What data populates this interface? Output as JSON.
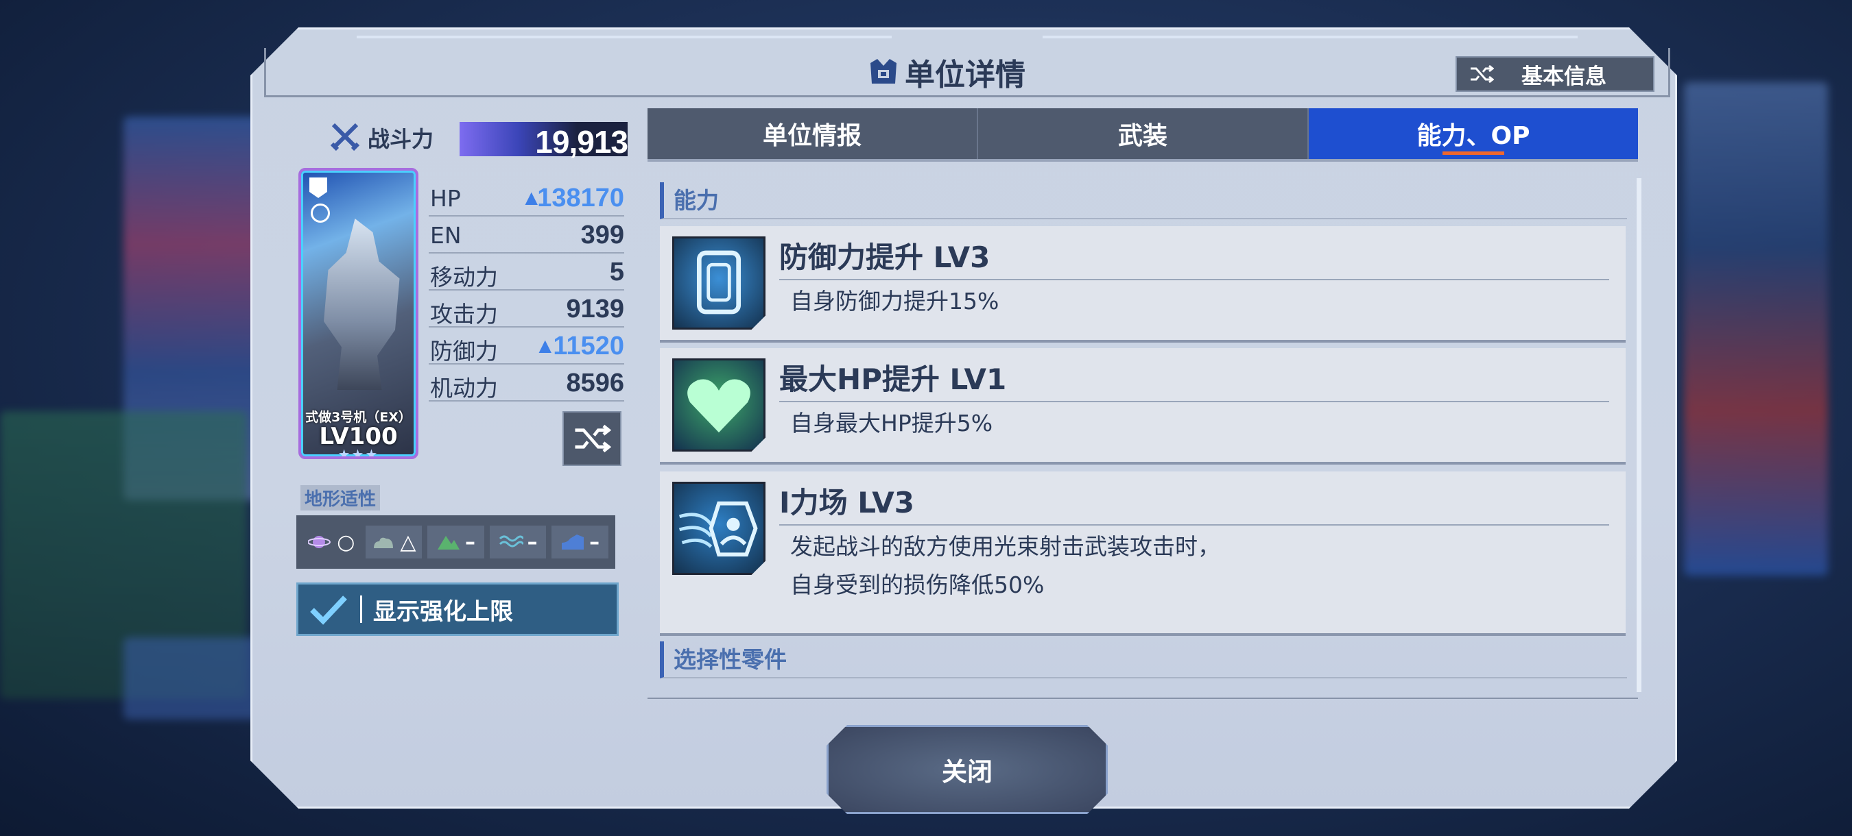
{
  "dialog": {
    "title": "单位详情",
    "basic_info_label": "基本信息",
    "close_label": "关闭"
  },
  "unit": {
    "power_label": "战斗力",
    "power_value": "19,913",
    "name": "式做3号机（EX）",
    "level": "LV100",
    "stars": "★★★",
    "stats": [
      {
        "label": "HP",
        "value": "138170",
        "boosted": true
      },
      {
        "label": "EN",
        "value": "399",
        "boosted": false
      },
      {
        "label": "移动力",
        "value": "5",
        "boosted": false
      },
      {
        "label": "攻击力",
        "value": "9139",
        "boosted": false
      },
      {
        "label": "防御力",
        "value": "11520",
        "boosted": true
      },
      {
        "label": "机动力",
        "value": "8596",
        "boosted": false
      }
    ]
  },
  "terrain": {
    "label": "地形适性",
    "items": [
      {
        "icon": "space-planet-icon",
        "grade": "○"
      },
      {
        "icon": "air-cloud-icon",
        "grade": "△"
      },
      {
        "icon": "land-mountain-icon",
        "grade": "–"
      },
      {
        "icon": "sea-wave-icon",
        "grade": "–"
      },
      {
        "icon": "underwater-icon",
        "grade": "–"
      }
    ]
  },
  "enhance_toggle": {
    "label": "显示强化上限",
    "checked": true
  },
  "tabs": [
    {
      "label": "单位情报",
      "active": false
    },
    {
      "label": "武装",
      "active": false
    },
    {
      "label": "能力、OP",
      "active": true
    }
  ],
  "abilities_section": "能力",
  "abilities": [
    {
      "name": "防御力提升 LV3",
      "desc": [
        "自身防御力提升15%"
      ],
      "icon": "shield-icon",
      "color": "#3b8fd6"
    },
    {
      "name": "最大HP提升 LV1",
      "desc": [
        "自身最大HP提升5%"
      ],
      "icon": "heart-icon",
      "color": "#3ea86a"
    },
    {
      "name": "I力场 LV3",
      "desc": [
        "发起战斗的敌方使用光束射击武装攻击时，",
        "自身受到的损伤降低50%"
      ],
      "icon": "i-field-icon",
      "color": "#2e7fc4"
    }
  ],
  "parts_section": "选择性零件",
  "colors": {
    "accent_blue": "#1e4fd0",
    "boost_blue": "#4a8ff0",
    "tab_underline": "#f0672c"
  }
}
